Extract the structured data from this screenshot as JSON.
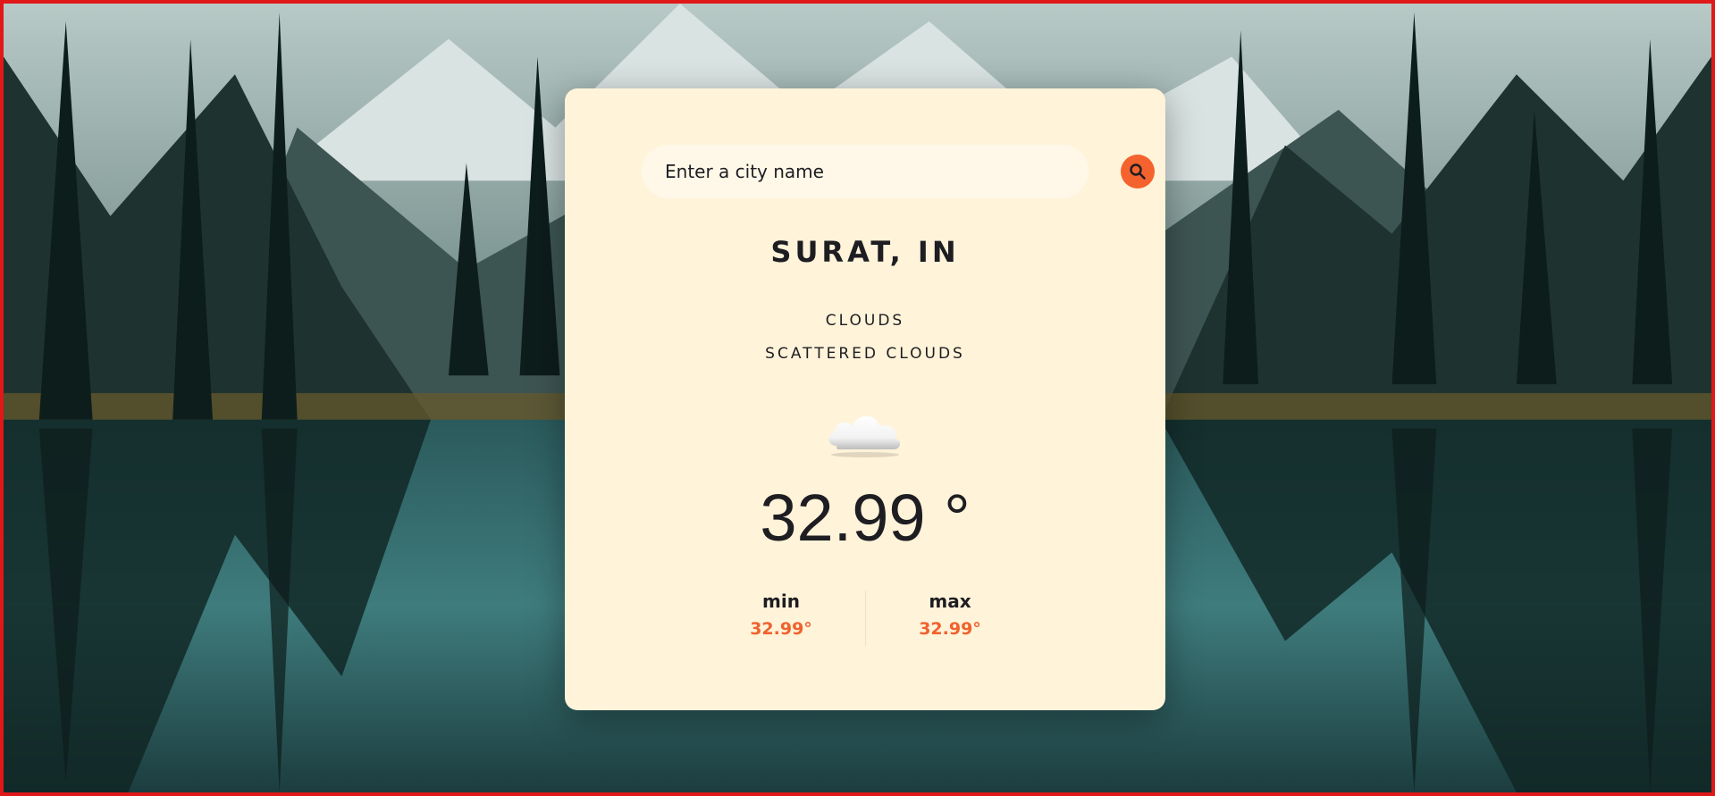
{
  "search": {
    "placeholder": "Enter a city name",
    "button_icon": "search-icon"
  },
  "location": {
    "name": "SURAT, IN"
  },
  "weather": {
    "main": "CLOUDS",
    "description": "SCATTERED CLOUDS",
    "icon": "cloud-icon",
    "temperature": "32.99 °",
    "min_label": "min",
    "min_value": "32.99°",
    "max_label": "max",
    "max_value": "32.99°"
  },
  "colors": {
    "card": "#fff3d9",
    "accent": "#f4622d",
    "text": "#1d1d22",
    "frame": "#e01818"
  }
}
